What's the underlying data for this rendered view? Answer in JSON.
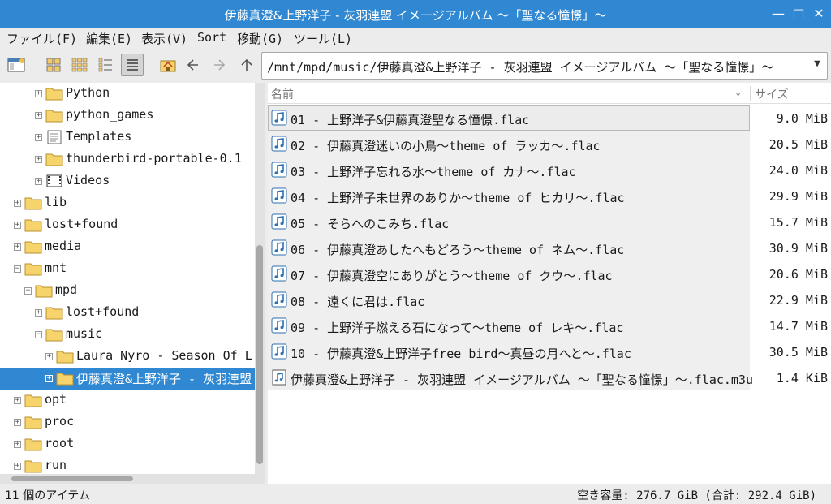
{
  "window": {
    "title": "伊藤真澄&上野洋子 - 灰羽連盟 イメージアルバム 〜「聖なる憧憬」〜",
    "min_glyph": "—",
    "max_glyph": "□",
    "close_glyph": "✕"
  },
  "menu": [
    "ファイル(F)",
    "編集(E)",
    "表示(V)",
    "Sort",
    "移動(G)",
    "ツール(L)"
  ],
  "toolbar": {
    "address": "/mnt/mpd/music/伊藤真澄&上野洋子 - 灰羽連盟 イメージアルバム 〜「聖なる憧憬」〜"
  },
  "tree": [
    {
      "label": "Python",
      "icon": "folder-icon",
      "expander": "+"
    },
    {
      "label": "python_games",
      "icon": "folder-icon",
      "expander": "+"
    },
    {
      "label": "Templates",
      "icon": "templates-folder-icon",
      "expander": "+"
    },
    {
      "label": "thunderbird-portable-0.1",
      "icon": "folder-icon",
      "expander": "+"
    },
    {
      "label": "Videos",
      "icon": "videos-folder-icon",
      "expander": "+"
    },
    {
      "label": "lib",
      "icon": "folder-icon",
      "expander": "+"
    },
    {
      "label": "lost+found",
      "icon": "folder-icon",
      "expander": "+"
    },
    {
      "label": "media",
      "icon": "folder-icon",
      "expander": "+"
    },
    {
      "label": "mnt",
      "icon": "folder-icon",
      "expander": "−"
    },
    {
      "label": "mpd",
      "icon": "folder-icon",
      "expander": "−"
    },
    {
      "label": "lost+found",
      "icon": "folder-icon",
      "expander": "+"
    },
    {
      "label": "music",
      "icon": "folder-icon",
      "expander": "−"
    },
    {
      "label": "Laura Nyro - Season Of L",
      "icon": "folder-icon",
      "expander": "+"
    },
    {
      "label": "伊藤真澄&上野洋子 - 灰羽連盟",
      "icon": "folder-icon",
      "expander": "+",
      "selected": true
    },
    {
      "label": "opt",
      "icon": "folder-icon",
      "expander": "+"
    },
    {
      "label": "proc",
      "icon": "folder-icon",
      "expander": "+"
    },
    {
      "label": "root",
      "icon": "folder-icon",
      "expander": "+"
    },
    {
      "label": "run",
      "icon": "folder-icon",
      "expander": "+"
    }
  ],
  "list": {
    "columns": {
      "name": "名前",
      "size": "サイズ"
    },
    "files": [
      {
        "name": "01 - 上野洋子&伊藤真澄聖なる憧憬.flac",
        "size": "9.0 MiB",
        "current": true
      },
      {
        "name": "02 - 伊藤真澄迷いの小鳥〜theme of ラッカ〜.flac",
        "size": "20.5 MiB"
      },
      {
        "name": "03 - 上野洋子忘れる水〜theme of カナ〜.flac",
        "size": "24.0 MiB"
      },
      {
        "name": "04 - 上野洋子未世界のありか〜theme of ヒカリ〜.flac",
        "size": "29.9 MiB"
      },
      {
        "name": "05 - そらへのこみち.flac",
        "size": "15.7 MiB"
      },
      {
        "name": "06 - 伊藤真澄あしたへもどろう〜theme of ネム〜.flac",
        "size": "30.9 MiB"
      },
      {
        "name": "07 - 伊藤真澄空にありがとう〜theme of クウ〜.flac",
        "size": "20.6 MiB"
      },
      {
        "name": "08 - 遠くに君は.flac",
        "size": "22.9 MiB"
      },
      {
        "name": "09 - 上野洋子燃える石になって〜theme of レキ〜.flac",
        "size": "14.7 MiB"
      },
      {
        "name": "10 - 伊藤真澄&上野洋子free bird〜真昼の月へと〜.flac",
        "size": "30.5 MiB"
      },
      {
        "name": "伊藤真澄&上野洋子 - 灰羽連盟 イメージアルバム 〜「聖なる憧憬」〜.flac.m3u",
        "size": "1.4 KiB"
      }
    ]
  },
  "status": {
    "items": "11 個のアイテム",
    "free": "空き容量: 276.7 GiB (合計: 292.4 GiB)"
  },
  "colors": {
    "accent": "#2f88d1",
    "folder": "#f6d36b"
  }
}
